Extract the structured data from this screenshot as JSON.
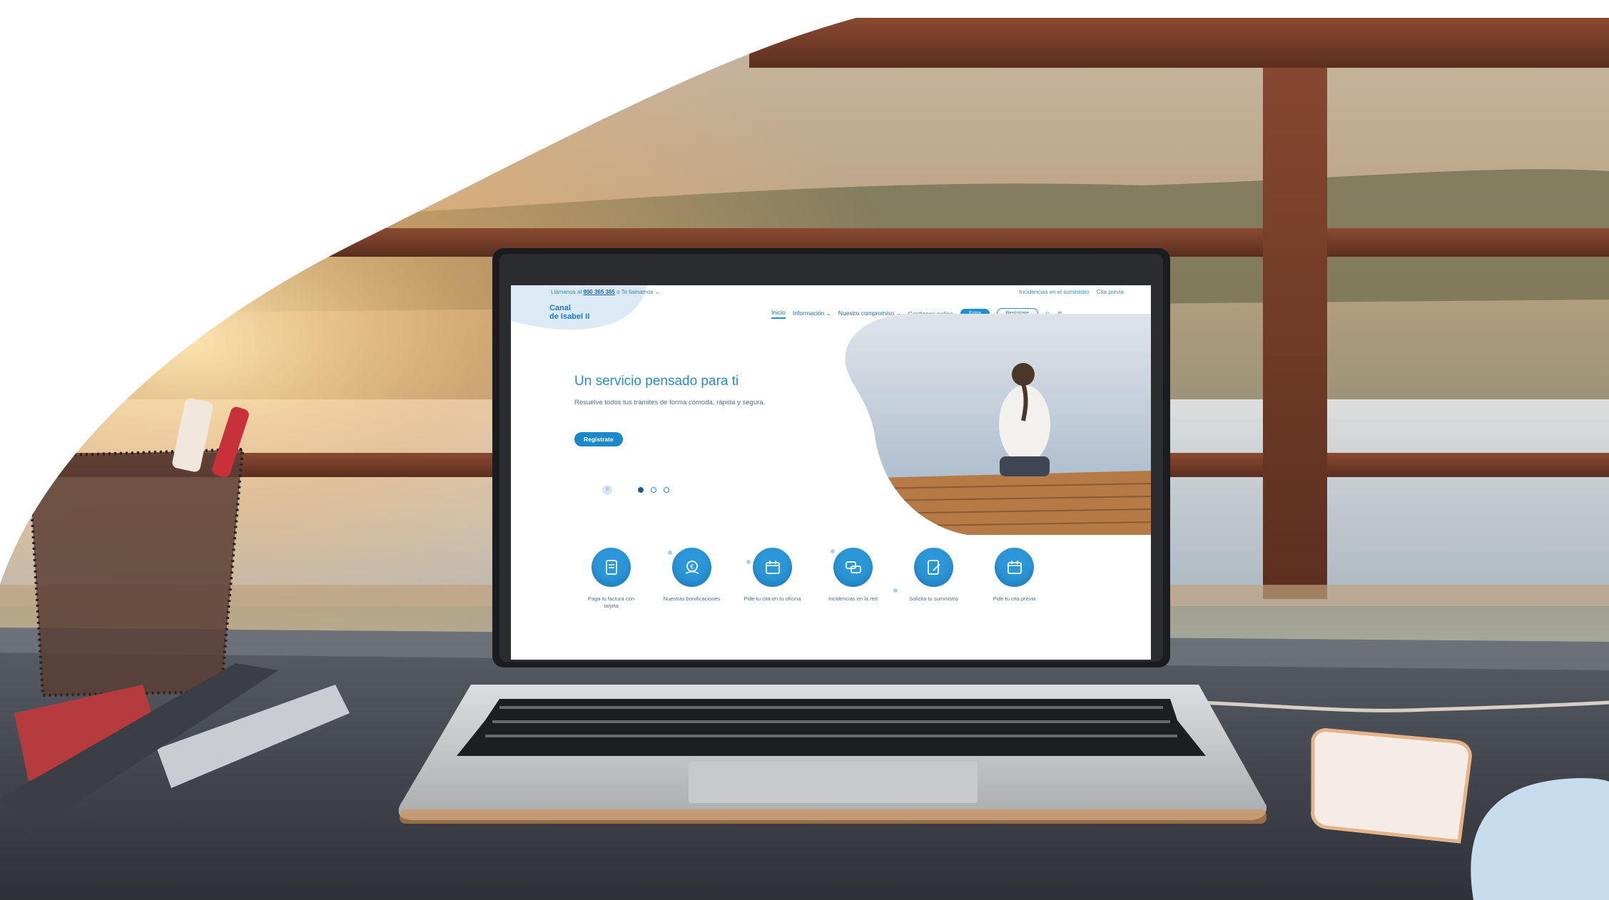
{
  "site": {
    "topbar": {
      "call_prefix": "Llámanos al",
      "phone": "900 365 365",
      "call_suffix": "o Te llamamos",
      "links": [
        "Incidencias en el suministro",
        "Cita previa"
      ]
    },
    "logo": {
      "line1": "Canal",
      "line2": "de Isabel II"
    },
    "nav": {
      "items": [
        "Inicio",
        "Información",
        "Nuestro compromiso",
        "Gestiones online"
      ],
      "enter_label": "Entra",
      "register_label": "Regístrate"
    },
    "hero": {
      "title": "Un servicio pensado para ti",
      "text": "Resuelve todos tus trámites de forma cómoda, rápida y segura.",
      "button": "Regístrate",
      "slides": 3,
      "active_slide": 1
    },
    "services": [
      {
        "label": "Paga tu factura con tarjeta",
        "icon": "invoice-icon"
      },
      {
        "label": "Nuestras bonificaciones",
        "icon": "euro-hand-icon"
      },
      {
        "label": "Pide tu cita en tu oficina",
        "icon": "calendar-icon"
      },
      {
        "label": "Incidencias en la red",
        "icon": "chat-icon"
      },
      {
        "label": "Solicita tu suministro",
        "icon": "form-icon"
      },
      {
        "label": "Pide tu cita previa",
        "icon": "calendar-icon"
      }
    ]
  },
  "colors": {
    "accent": "#1f8fd1",
    "brand": "#2a8ad2",
    "blob_light": "#dceaf5"
  }
}
